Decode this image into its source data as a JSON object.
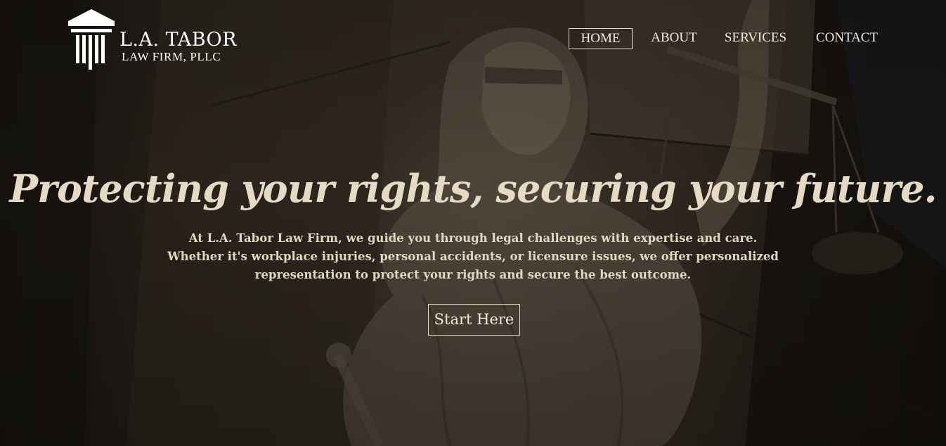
{
  "brand": {
    "name": "L.A. TABOR",
    "subtitle": "LAW FIRM, PLLC",
    "icon": "courthouse-pillars-icon"
  },
  "nav": {
    "items": [
      {
        "label": "HOME",
        "active": true
      },
      {
        "label": "ABOUT",
        "active": false
      },
      {
        "label": "SERVICES",
        "active": false
      },
      {
        "label": "CONTACT",
        "active": false
      }
    ]
  },
  "hero": {
    "headline": "Protecting your rights, securing your future.",
    "body": "At L.A. Tabor Law Firm, we guide you through legal challenges with expertise and care. Whether it's workplace injuries, personal accidents, or licensure issues, we offer personalized representation to protect your rights and secure the best outcome.",
    "cta_label": "Start Here",
    "background": "lady-justice-statue-image"
  },
  "colors": {
    "headline": "#e7dac4",
    "text": "#f1e9db",
    "background": "#1c1813"
  }
}
